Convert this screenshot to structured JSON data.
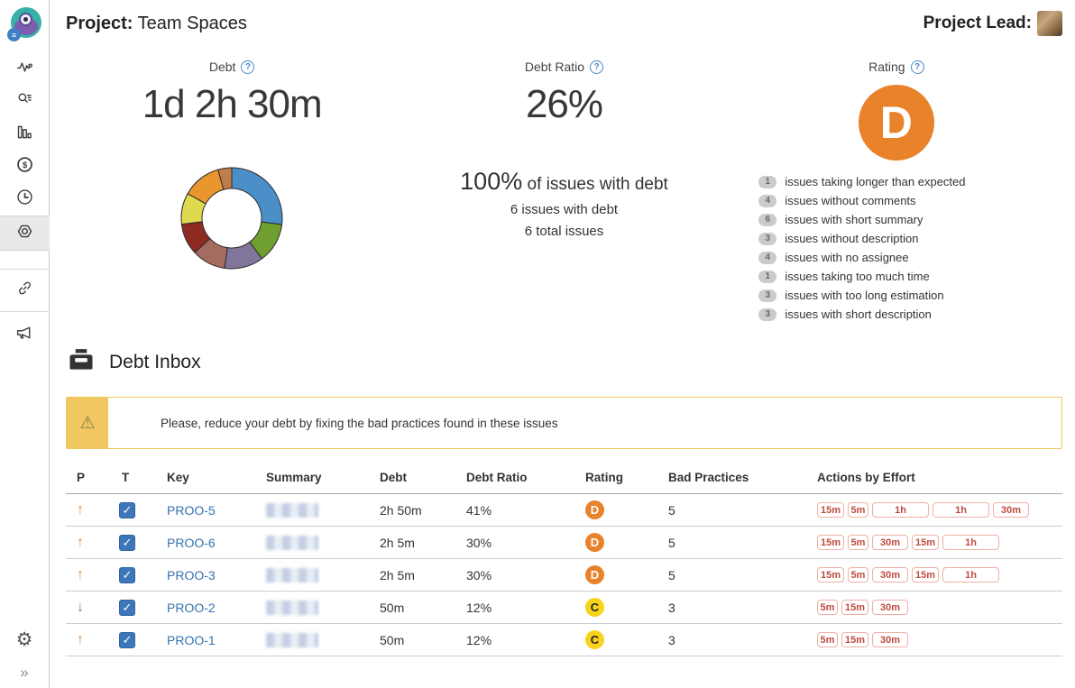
{
  "header": {
    "project_label": "Project:",
    "project_name": " Team Spaces",
    "lead_label": "Project Lead:"
  },
  "metrics": {
    "debt": {
      "label": "Debt",
      "value": "1d 2h 30m"
    },
    "debt_ratio": {
      "label": "Debt Ratio",
      "value": "26%",
      "highlight": "100%",
      "highlight_suffix": " of issues with debt",
      "issues_with_debt": "6 issues with debt",
      "total_issues": "6 total issues"
    },
    "rating": {
      "label": "Rating",
      "grade": "D",
      "grade_color": "#e8822b",
      "breakdown": [
        {
          "count": "1",
          "label": "issues taking longer than expected"
        },
        {
          "count": "4",
          "label": "issues without comments"
        },
        {
          "count": "6",
          "label": "issues with short summary"
        },
        {
          "count": "3",
          "label": "issues without description"
        },
        {
          "count": "4",
          "label": "issues with no assignee"
        },
        {
          "count": "1",
          "label": "issues taking too much time"
        },
        {
          "count": "3",
          "label": "issues with too long estimation"
        },
        {
          "count": "3",
          "label": "issues with short description"
        }
      ]
    }
  },
  "chart_data": {
    "type": "donut",
    "title": "",
    "legend": false,
    "segments": [
      {
        "color": "#4a8fc7",
        "fraction": 0.27
      },
      {
        "color": "#6f9f2f",
        "fraction": 0.128
      },
      {
        "color": "#80769b",
        "fraction": 0.125
      },
      {
        "color": "#a56b60",
        "fraction": 0.108
      },
      {
        "color": "#8e2b20",
        "fraction": 0.1
      },
      {
        "color": "#dfd94d",
        "fraction": 0.1
      },
      {
        "color": "#e9962e",
        "fraction": 0.125
      },
      {
        "color": "#c17d49",
        "fraction": 0.044
      }
    ]
  },
  "debt_inbox": {
    "title": "Debt Inbox",
    "warning": "Please, reduce your debt by fixing the bad practices found in these issues",
    "table": {
      "columns": [
        "P",
        "T",
        "Key",
        "Summary",
        "Debt",
        "Debt Ratio",
        "Rating",
        "Bad Practices",
        "Actions by Effort"
      ],
      "rows": [
        {
          "priority": "up",
          "checked": true,
          "key": "PROO-5",
          "debt": "2h 50m",
          "debt_ratio": "41%",
          "rating": "D",
          "bad_practices": "5",
          "actions": [
            "15m",
            "5m",
            "1h",
            "1h",
            "30m"
          ]
        },
        {
          "priority": "up",
          "checked": true,
          "key": "PROO-6",
          "debt": "2h 5m",
          "debt_ratio": "30%",
          "rating": "D",
          "bad_practices": "5",
          "actions": [
            "15m",
            "5m",
            "30m",
            "15m",
            "1h"
          ]
        },
        {
          "priority": "up",
          "checked": true,
          "key": "PROO-3",
          "debt": "2h 5m",
          "debt_ratio": "30%",
          "rating": "D",
          "bad_practices": "5",
          "actions": [
            "15m",
            "5m",
            "30m",
            "15m",
            "1h"
          ]
        },
        {
          "priority": "down",
          "checked": true,
          "key": "PROO-2",
          "debt": "50m",
          "debt_ratio": "12%",
          "rating": "C",
          "bad_practices": "3",
          "actions": [
            "5m",
            "15m",
            "30m"
          ]
        },
        {
          "priority": "up",
          "checked": true,
          "key": "PROO-1",
          "debt": "50m",
          "debt_ratio": "12%",
          "rating": "C",
          "bad_practices": "3",
          "actions": [
            "5m",
            "15m",
            "30m"
          ]
        }
      ]
    }
  },
  "colors": {
    "rating_d": "#e8822b",
    "rating_c": "#f7d31b",
    "link": "#3572b0",
    "pill_border": "#efb0a6",
    "pill_text": "#bf4b3f",
    "warning_accent": "#f0c75a",
    "up_arrow": "#e18b3d",
    "down_arrow": "#5f9e4d"
  },
  "sidebar": {
    "items": [
      "logo",
      "activity",
      "search",
      "bar-chart",
      "money",
      "clock",
      "settings-nut",
      "link",
      "megaphone"
    ],
    "bottom": [
      "gear",
      "expand"
    ]
  }
}
